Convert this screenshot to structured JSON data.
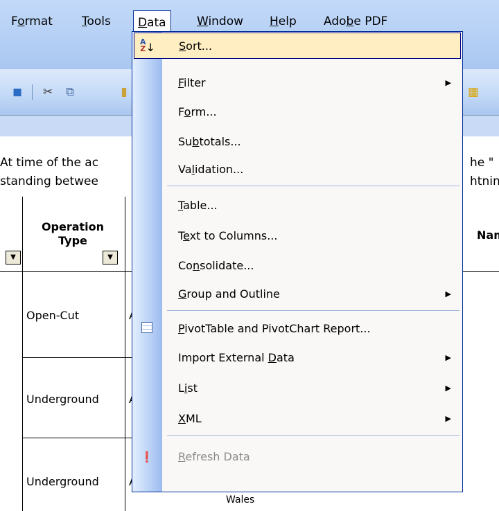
{
  "menubar": {
    "items": [
      {
        "pre": "F",
        "u": "o",
        "post": "rmat"
      },
      {
        "pre": "",
        "u": "T",
        "post": "ools"
      },
      {
        "pre": "",
        "u": "D",
        "post": "ata"
      },
      {
        "pre": "",
        "u": "W",
        "post": "indow"
      },
      {
        "pre": "",
        "u": "H",
        "post": "elp"
      },
      {
        "pre": "Ado",
        "u": "b",
        "post": "e PDF"
      }
    ]
  },
  "sheet": {
    "line1_left": "At time of the ac",
    "line2_left": "standing betwee",
    "line1_right": "he \"",
    "line2_right": "htnin",
    "header_operation": "Operation",
    "header_type": "Type",
    "header_name_fragment": "Name",
    "rows": [
      {
        "type": "Open-Cut",
        "frag": "A"
      },
      {
        "type": "Underground",
        "frag": "A"
      },
      {
        "type": "Underground",
        "frag": "A"
      }
    ],
    "bottom_fragment": "Wales"
  },
  "data_menu": {
    "items": [
      {
        "pre": "",
        "u": "S",
        "post": "ort...",
        "icon": "sort-ascending-icon",
        "glyph": "A↓",
        "highlighted": true,
        "submenu": false,
        "disabled": false
      },
      {
        "pre": "",
        "u": "F",
        "post": "ilter",
        "submenu": true
      },
      {
        "pre": "F",
        "u": "o",
        "post": "rm...",
        "submenu": false
      },
      {
        "pre": "Su",
        "u": "b",
        "post": "totals...",
        "submenu": false
      },
      {
        "pre": "Va",
        "u": "l",
        "post": "idation...",
        "submenu": false
      },
      {
        "pre": "",
        "u": "T",
        "post": "able...",
        "submenu": false
      },
      {
        "pre": "T",
        "u": "e",
        "post": "xt to Columns...",
        "submenu": false
      },
      {
        "pre": "Co",
        "u": "n",
        "post": "solidate...",
        "submenu": false
      },
      {
        "pre": "",
        "u": "G",
        "post": "roup and Outline",
        "submenu": true
      },
      {
        "pre": "",
        "u": "P",
        "post": "ivotTable and PivotChart Report...",
        "icon": "pivottable-icon",
        "submenu": false
      },
      {
        "pre": "Import External ",
        "u": "D",
        "post": "ata",
        "submenu": true
      },
      {
        "pre": "L",
        "u": "i",
        "post": "st",
        "submenu": true
      },
      {
        "pre": "",
        "u": "X",
        "post": "ML",
        "submenu": true
      },
      {
        "pre": "",
        "u": "R",
        "post": "efresh Data",
        "icon": "refresh-data-icon",
        "disabled": true,
        "submenu": false
      }
    ],
    "arrow_glyph": "▶"
  },
  "colors": {
    "menu_border": "#002d96",
    "highlight": "#ffeec2",
    "disabled_text": "#8d8d8d"
  }
}
